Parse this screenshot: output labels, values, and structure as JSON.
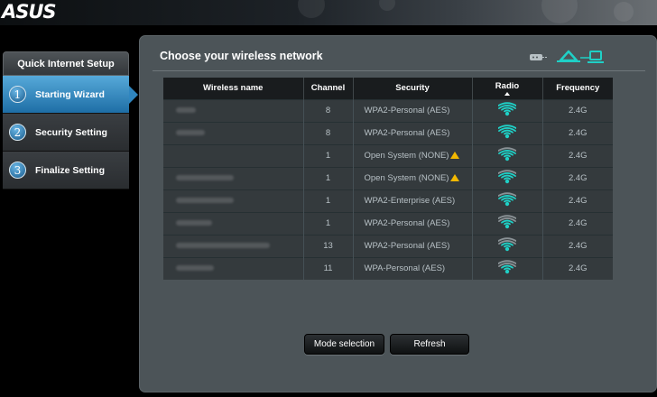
{
  "brand": {
    "logo_text": "ASUS"
  },
  "sidebar": {
    "title": "Quick Internet Setup",
    "steps": [
      {
        "number": "1",
        "label": "Starting Wizard",
        "active": true
      },
      {
        "number": "2",
        "label": "Security Setting",
        "active": false
      },
      {
        "number": "3",
        "label": "Finalize Setting",
        "active": false
      }
    ]
  },
  "panel": {
    "title": "Choose your wireless network"
  },
  "table": {
    "headers": {
      "name": "Wireless name",
      "channel": "Channel",
      "security": "Security",
      "radio": "Radio",
      "frequency": "Frequency"
    },
    "rows": [
      {
        "channel": "8",
        "security": "WPA2-Personal (AES)",
        "warning": false,
        "signal": 4,
        "frequency": "2.4G"
      },
      {
        "channel": "8",
        "security": "WPA2-Personal (AES)",
        "warning": false,
        "signal": 4,
        "frequency": "2.4G"
      },
      {
        "channel": "1",
        "security": "Open System (NONE)",
        "warning": true,
        "signal": 3,
        "frequency": "2.4G"
      },
      {
        "channel": "1",
        "security": "Open System (NONE)",
        "warning": true,
        "signal": 3,
        "frequency": "2.4G"
      },
      {
        "channel": "1",
        "security": "WPA2-Enterprise (AES)",
        "warning": false,
        "signal": 3,
        "frequency": "2.4G"
      },
      {
        "channel": "1",
        "security": "WPA2-Personal (AES)",
        "warning": false,
        "signal": 2,
        "frequency": "2.4G"
      },
      {
        "channel": "13",
        "security": "WPA2-Personal (AES)",
        "warning": false,
        "signal": 2,
        "frequency": "2.4G"
      },
      {
        "channel": "11",
        "security": "WPA-Personal (AES)",
        "warning": false,
        "signal": 2,
        "frequency": "2.4G"
      }
    ]
  },
  "buttons": {
    "mode_selection": "Mode selection",
    "refresh": "Refresh"
  },
  "colors": {
    "accent": "#1fd0c6",
    "step_active": "#2f86c0",
    "warning": "#f3b800"
  }
}
